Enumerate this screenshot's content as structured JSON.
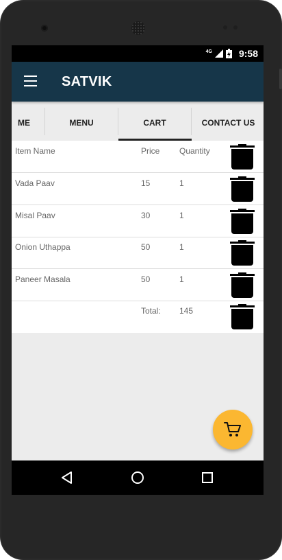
{
  "status_bar": {
    "network": "4G",
    "time": "9:58"
  },
  "app_bar": {
    "title": "SATVIK",
    "menu_icon": "hamburger-menu-icon"
  },
  "tabs": [
    {
      "label": "ME",
      "selected": false
    },
    {
      "label": "MENU",
      "selected": false
    },
    {
      "label": "CART",
      "selected": true
    },
    {
      "label": "CONTACT US",
      "selected": false
    }
  ],
  "cart": {
    "header": {
      "name": "Item Name",
      "price": "Price",
      "quantity": "Quantity"
    },
    "items": [
      {
        "name": "Vada Paav",
        "price": "15",
        "quantity": "1"
      },
      {
        "name": "Misal Paav",
        "price": "30",
        "quantity": "1"
      },
      {
        "name": "Onion Uthappa",
        "price": "50",
        "quantity": "1"
      },
      {
        "name": "Paneer Masala",
        "price": "50",
        "quantity": "1"
      }
    ],
    "total": {
      "label": "Total:",
      "value": "145"
    },
    "delete_icon": "trash-icon"
  },
  "fab": {
    "icon": "cart-icon",
    "color": "#fbb731"
  },
  "colors": {
    "app_bar": "#163649",
    "screen_bg": "#ececec"
  },
  "nav_bar": {
    "icons": [
      "back-icon",
      "home-icon",
      "recents-icon"
    ]
  }
}
